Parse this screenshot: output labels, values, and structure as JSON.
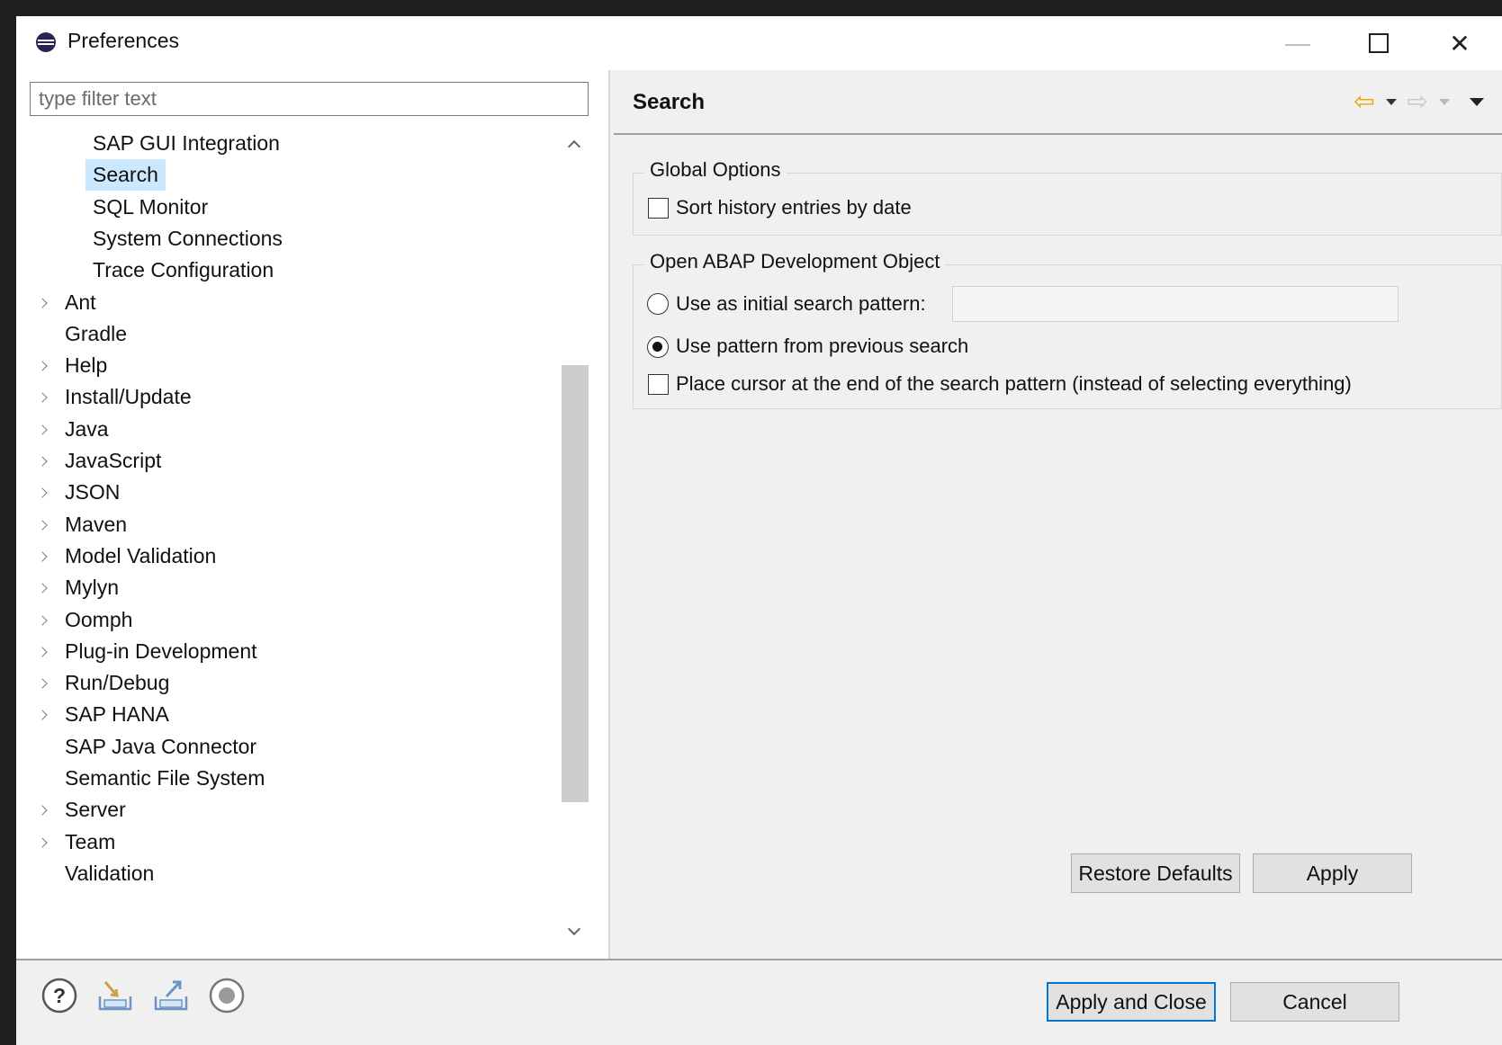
{
  "window": {
    "title": "Preferences",
    "controls": {
      "minimize": "—",
      "close": "✕"
    }
  },
  "filter": {
    "placeholder": "type filter text",
    "value": ""
  },
  "tree": {
    "items": [
      {
        "label": "SAP GUI Integration",
        "indent": 2,
        "expandable": false,
        "selected": false
      },
      {
        "label": "Search",
        "indent": 2,
        "expandable": false,
        "selected": true
      },
      {
        "label": "SQL Monitor",
        "indent": 2,
        "expandable": false,
        "selected": false
      },
      {
        "label": "System Connections",
        "indent": 2,
        "expandable": false,
        "selected": false
      },
      {
        "label": "Trace Configuration",
        "indent": 2,
        "expandable": false,
        "selected": false
      },
      {
        "label": "Ant",
        "indent": 1,
        "expandable": true,
        "selected": false
      },
      {
        "label": "Gradle",
        "indent": 1,
        "expandable": false,
        "selected": false
      },
      {
        "label": "Help",
        "indent": 1,
        "expandable": true,
        "selected": false
      },
      {
        "label": "Install/Update",
        "indent": 1,
        "expandable": true,
        "selected": false
      },
      {
        "label": "Java",
        "indent": 1,
        "expandable": true,
        "selected": false
      },
      {
        "label": "JavaScript",
        "indent": 1,
        "expandable": true,
        "selected": false
      },
      {
        "label": "JSON",
        "indent": 1,
        "expandable": true,
        "selected": false
      },
      {
        "label": "Maven",
        "indent": 1,
        "expandable": true,
        "selected": false
      },
      {
        "label": "Model Validation",
        "indent": 1,
        "expandable": true,
        "selected": false
      },
      {
        "label": "Mylyn",
        "indent": 1,
        "expandable": true,
        "selected": false
      },
      {
        "label": "Oomph",
        "indent": 1,
        "expandable": true,
        "selected": false
      },
      {
        "label": "Plug-in Development",
        "indent": 1,
        "expandable": true,
        "selected": false
      },
      {
        "label": "Run/Debug",
        "indent": 1,
        "expandable": true,
        "selected": false
      },
      {
        "label": "SAP HANA",
        "indent": 1,
        "expandable": true,
        "selected": false
      },
      {
        "label": "SAP Java Connector",
        "indent": 1,
        "expandable": false,
        "selected": false
      },
      {
        "label": "Semantic File System",
        "indent": 1,
        "expandable": false,
        "selected": false
      },
      {
        "label": "Server",
        "indent": 1,
        "expandable": true,
        "selected": false
      },
      {
        "label": "Team",
        "indent": 1,
        "expandable": true,
        "selected": false
      },
      {
        "label": "Validation",
        "indent": 1,
        "expandable": false,
        "selected": false
      }
    ]
  },
  "page": {
    "title": "Search",
    "nav": {
      "back": "⇦",
      "forward": "⇨"
    }
  },
  "global_options": {
    "legend": "Global Options",
    "sort_history_label": "Sort history entries by date",
    "sort_history_checked": false
  },
  "open_object": {
    "legend": "Open ABAP Development Object",
    "initial_pattern_label": "Use as initial search pattern:",
    "initial_pattern_value": "",
    "previous_search_label": "Use pattern from previous search",
    "selected_option": "previous_search",
    "cursor_end_label": "Place cursor at the end of the search pattern (instead of selecting everything)",
    "cursor_end_checked": false
  },
  "buttons": {
    "restore_defaults": "Restore Defaults",
    "apply": "Apply",
    "apply_and_close": "Apply and Close",
    "cancel": "Cancel"
  },
  "bottom_icons": [
    "help-icon",
    "import-icon",
    "export-icon",
    "record-icon"
  ],
  "colors": {
    "selection": "#cce8ff",
    "default_button_border": "#0078d7",
    "back_arrow": "#e8a700",
    "dialog_background": "#f0f0f0"
  }
}
